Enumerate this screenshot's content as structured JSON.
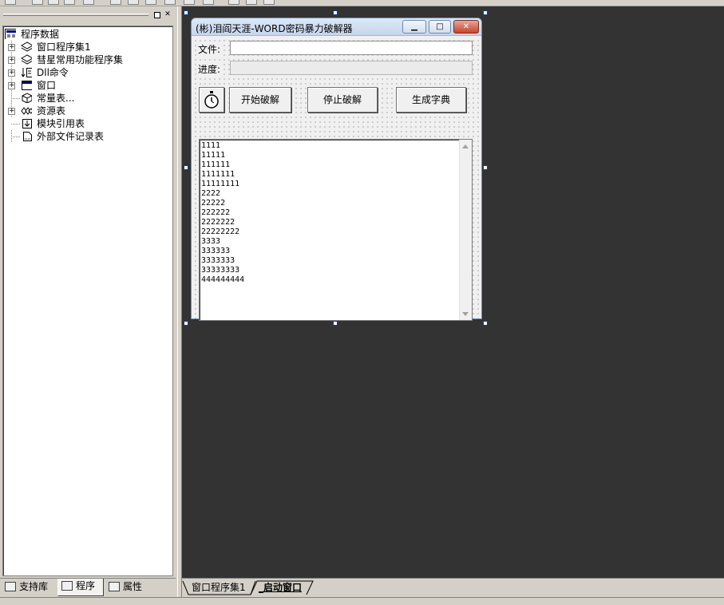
{
  "left_panel": {
    "tree": {
      "root": "程序数据",
      "items": [
        {
          "label": "窗口程序集1",
          "expandable": true,
          "icon": "program-set-icon"
        },
        {
          "label": "彗星常用功能程序集",
          "expandable": true,
          "icon": "program-set-icon"
        },
        {
          "label": "Dll命令",
          "expandable": true,
          "icon": "dll-icon"
        },
        {
          "label": "窗口",
          "expandable": true,
          "icon": "window-icon"
        },
        {
          "label": "常量表...",
          "expandable": false,
          "icon": "constant-icon"
        },
        {
          "label": "资源表",
          "expandable": true,
          "icon": "resource-icon"
        },
        {
          "label": "模块引用表",
          "expandable": false,
          "icon": "module-ref-icon"
        },
        {
          "label": "外部文件记录表",
          "expandable": false,
          "icon": "file-record-icon"
        }
      ]
    },
    "tabs": [
      "支持库",
      "程序",
      "属性"
    ],
    "active_tab": "程序"
  },
  "form": {
    "title": "(彬)泪阎天涯-WORD密码暴力破解器",
    "file_label": "文件:",
    "file_value": "",
    "progress_label": "进度:",
    "progress_value": 0,
    "buttons": {
      "start": "开始破解",
      "stop": "停止破解",
      "dict": "生成字典"
    },
    "log_lines": [
      "1111",
      "11111",
      "111111",
      "1111111",
      "11111111",
      "2222",
      "22222",
      "222222",
      "2222222",
      "22222222",
      "3333",
      "333333",
      "3333333",
      "33333333",
      "444444444"
    ]
  },
  "design_tabs": [
    "窗口程序集1",
    "_启动窗口"
  ],
  "active_design_tab": "_启动窗口",
  "colors": {
    "designer_bg": "#333333",
    "chrome": "#d4d0c8",
    "handle_border": "#1a3a8a"
  }
}
